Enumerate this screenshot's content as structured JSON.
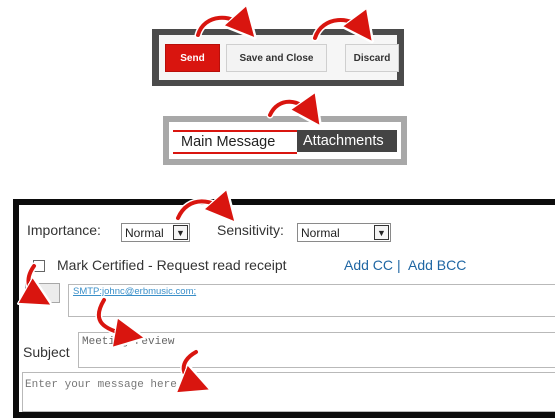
{
  "toolbar": {
    "send_label": "Send",
    "save_close_label": "Save and Close",
    "discard_label": "Discard"
  },
  "tabs": [
    {
      "label": "Main Message",
      "active": true
    },
    {
      "label": "Attachments",
      "active": false
    }
  ],
  "form": {
    "importance_label": "Importance:",
    "importance_value": "Normal",
    "sensitivity_label": "Sensitivity:",
    "sensitivity_value": "Normal",
    "certified_label": "Mark Certified - Request read receipt",
    "certified_checked": false,
    "add_cc_label": "Add CC",
    "separator": "|",
    "add_bcc_label": "Add BCC",
    "to_value": "SMTP:johnc@erbmusic.com;",
    "subject_label": "Subject",
    "subject_value": "Meeting review",
    "message_placeholder": "Enter your message here."
  },
  "colors": {
    "accent_red": "#d9150f",
    "link_blue": "#1f66a3",
    "dark_panel": "#444444"
  }
}
